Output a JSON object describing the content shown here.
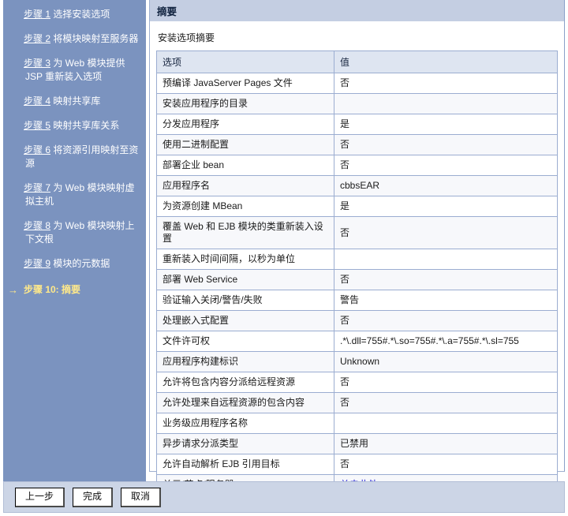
{
  "sidebar": {
    "steps": [
      {
        "num": "步骤 1",
        "text": " 选择安装选项"
      },
      {
        "num": "步骤 2",
        "text": " 将模块映射至服务器"
      },
      {
        "num": "步骤 3",
        "text": " 为 Web 模块提供 JSP 重新装入选项"
      },
      {
        "num": "步骤 4",
        "text": " 映射共享库"
      },
      {
        "num": "步骤 5",
        "text": " 映射共享库关系"
      },
      {
        "num": "步骤 6",
        "text": " 将资源引用映射至资源"
      },
      {
        "num": "步骤 7",
        "text": " 为 Web 模块映射虚拟主机"
      },
      {
        "num": "步骤 8",
        "text": " 为 Web 模块映射上下文根"
      },
      {
        "num": "步骤 9",
        "text": " 模块的元数据"
      }
    ],
    "current_step": {
      "arrow": "→",
      "label": "步骤 10: 摘要"
    }
  },
  "panel": {
    "title": "摘要",
    "section_label": "安装选项摘要"
  },
  "table": {
    "headers": [
      "选项",
      "值"
    ],
    "rows": [
      {
        "option": "预编译 JavaServer Pages 文件",
        "value": "否"
      },
      {
        "option": "安装应用程序的目录",
        "value": ""
      },
      {
        "option": "分发应用程序",
        "value": "是"
      },
      {
        "option": "使用二进制配置",
        "value": "否"
      },
      {
        "option": "部署企业 bean",
        "value": "否"
      },
      {
        "option": "应用程序名",
        "value": "cbbsEAR"
      },
      {
        "option": "为资源创建 MBean",
        "value": "是"
      },
      {
        "option": "覆盖 Web 和 EJB 模块的类重新装入设置",
        "value": "否"
      },
      {
        "option": "重新装入时间间隔，以秒为单位",
        "value": ""
      },
      {
        "option": "部署 Web Service",
        "value": "否"
      },
      {
        "option": "验证输入关闭/警告/失败",
        "value": "警告"
      },
      {
        "option": "处理嵌入式配置",
        "value": "否"
      },
      {
        "option": "文件许可权",
        "value": ".*\\.dll=755#.*\\.so=755#.*\\.a=755#.*\\.sl=755"
      },
      {
        "option": "应用程序构建标识",
        "value": "Unknown"
      },
      {
        "option": "允许将包含内容分派给远程资源",
        "value": "否"
      },
      {
        "option": "允许处理来自远程资源的包含内容",
        "value": "否"
      },
      {
        "option": "业务级应用程序名称",
        "value": ""
      },
      {
        "option": "异步请求分派类型",
        "value": "已禁用"
      },
      {
        "option": "允许自动解析 EJB 引用目标",
        "value": "否"
      },
      {
        "option": "单元/节点/服务器",
        "value": "单击此处",
        "is_link": true
      }
    ]
  },
  "buttons": {
    "previous": "上一步",
    "finish": "完成",
    "cancel": "取消"
  },
  "colors": {
    "sidebar_bg": "#7b93bf",
    "header_bg": "#c4cee2",
    "table_header_bg": "#dee5f1",
    "current_step": "#ffe98a",
    "link": "#2424d6",
    "button_bar_bg": "#ccd5e6"
  }
}
